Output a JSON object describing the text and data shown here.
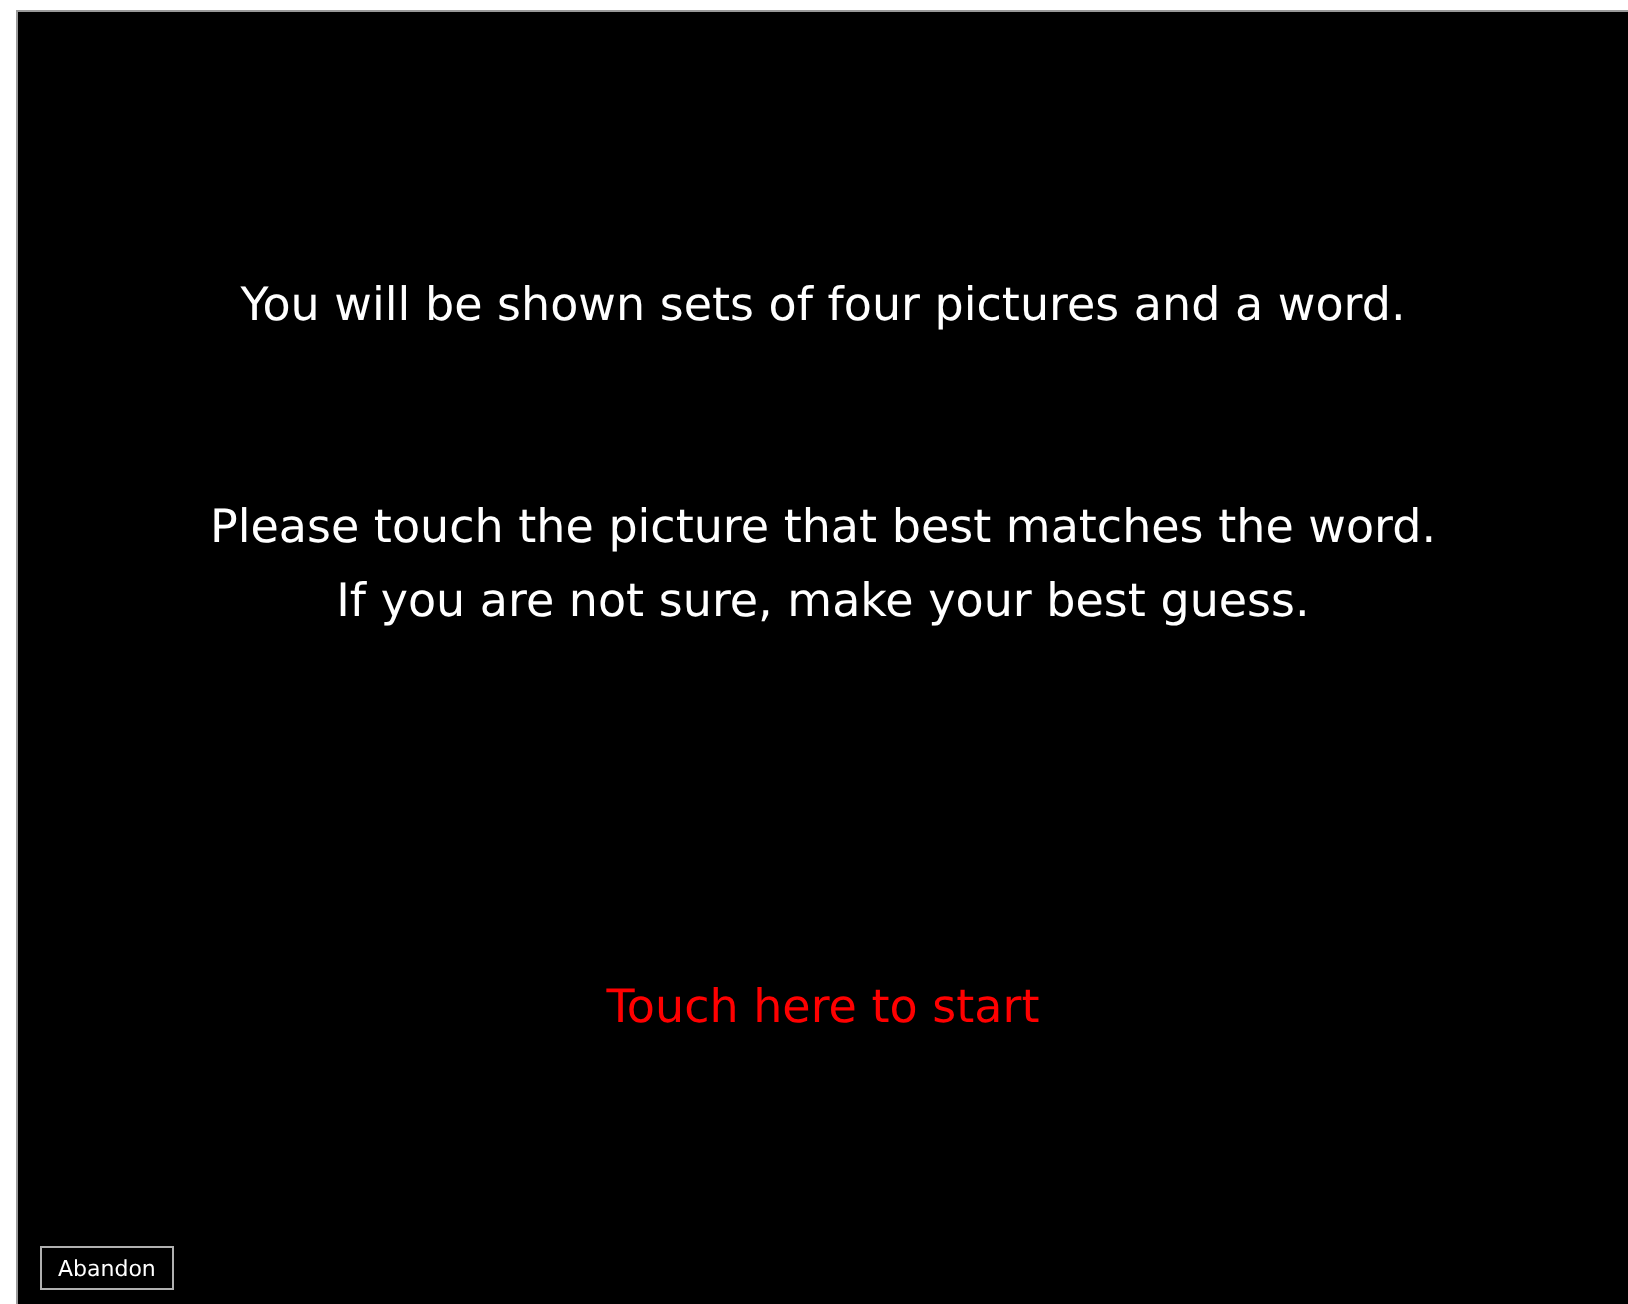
{
  "instructions": [
    "You will be shown sets of four pictures and a word.",
    "Please touch the picture that best matches the word.\nIf you are not sure, make your best guess."
  ],
  "start_prompt": "Touch here to start",
  "buttons": [
    "Abandon"
  ]
}
